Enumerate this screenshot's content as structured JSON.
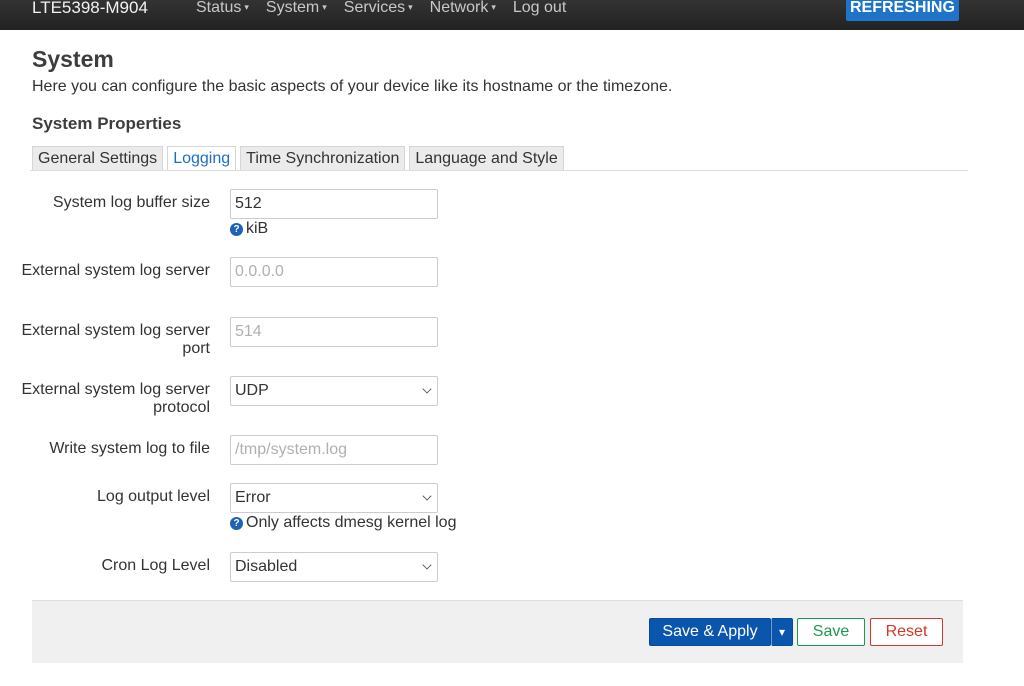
{
  "navbar": {
    "brand": "LTE5398-M904",
    "menu": [
      {
        "label": "Status",
        "has_caret": true
      },
      {
        "label": "System",
        "has_caret": true
      },
      {
        "label": "Services",
        "has_caret": true
      },
      {
        "label": "Network",
        "has_caret": true
      },
      {
        "label": "Log out",
        "has_caret": false
      }
    ],
    "caret": "▾",
    "status_badge": "REFRESHING"
  },
  "page": {
    "title": "System",
    "description": "Here you can configure the basic aspects of your device like its hostname or the timezone.",
    "section_title": "System Properties"
  },
  "tabs": [
    {
      "label": "General Settings",
      "active": false
    },
    {
      "label": "Logging",
      "active": true
    },
    {
      "label": "Time Synchronization",
      "active": false
    },
    {
      "label": "Language and Style",
      "active": false
    }
  ],
  "form": {
    "log_buffer": {
      "label": "System log buffer size",
      "value": "512",
      "placeholder": "",
      "hint": "kiB"
    },
    "log_server": {
      "label": "External system log server",
      "value": "",
      "placeholder": "0.0.0.0"
    },
    "log_port": {
      "label": "External system log server port",
      "value": "",
      "placeholder": "514"
    },
    "log_proto": {
      "label": "External system log server protocol",
      "value": "UDP"
    },
    "log_file": {
      "label": "Write system log to file",
      "value": "",
      "placeholder": "/tmp/system.log"
    },
    "log_level": {
      "label": "Log output level",
      "value": "Error",
      "hint": "Only affects dmesg kernel log"
    },
    "cron_level": {
      "label": "Cron Log Level",
      "value": "Disabled"
    }
  },
  "help_glyph": "?",
  "actions": {
    "save_apply": "Save & Apply",
    "dropdown_glyph": "▾",
    "save": "Save",
    "reset": "Reset"
  },
  "colors": {
    "navbar_bg": "#2d2d2d",
    "badge_bg": "#1e74c8",
    "active_tab": "#1b6fc1",
    "apply_button": "#0b56ad",
    "save_button": "#1a9a50",
    "reset_button": "#d0392b"
  }
}
